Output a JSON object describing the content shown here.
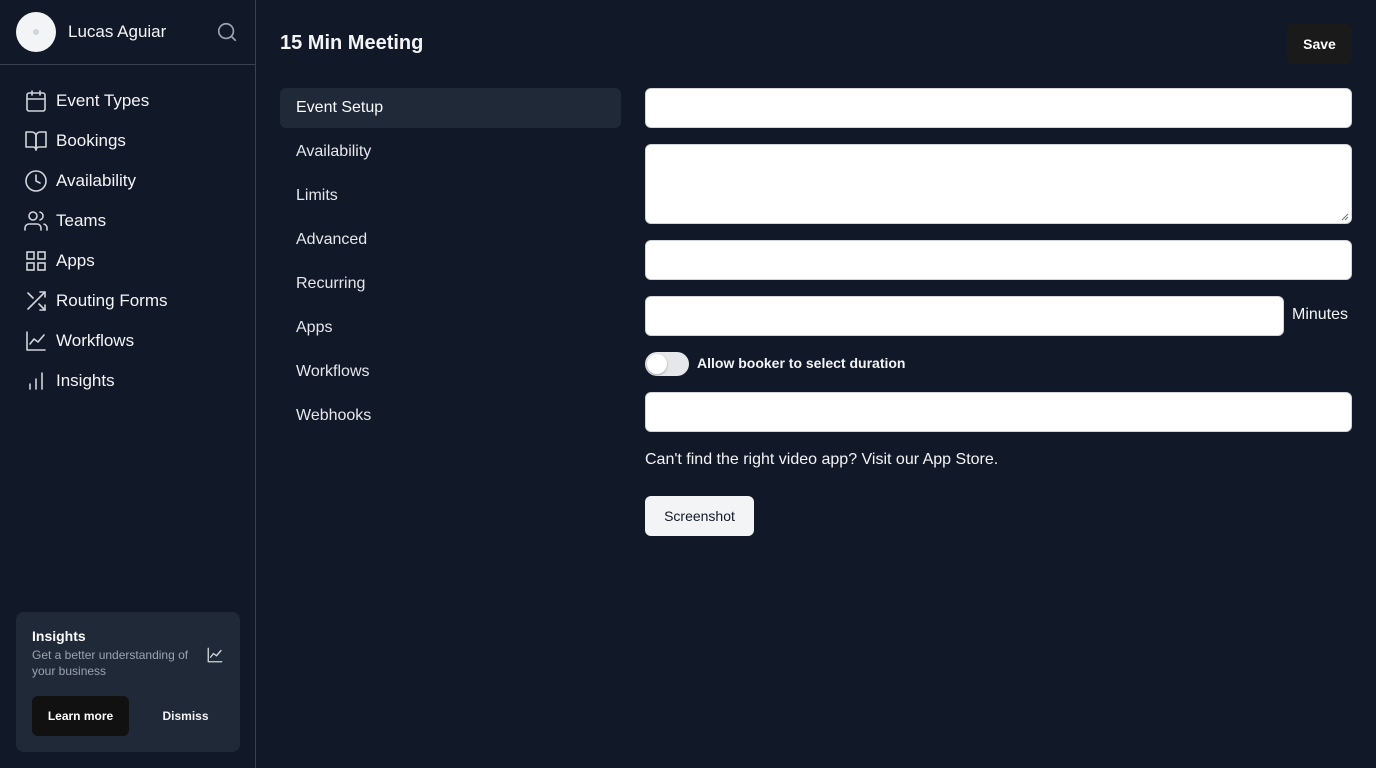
{
  "user": {
    "name": "Lucas Aguiar"
  },
  "sidebar": {
    "items": [
      {
        "label": "Event Types",
        "icon": "calendar-icon"
      },
      {
        "label": "Bookings",
        "icon": "book-open-icon"
      },
      {
        "label": "Availability",
        "icon": "clock-icon"
      },
      {
        "label": "Teams",
        "icon": "users-icon"
      },
      {
        "label": "Apps",
        "icon": "grid-icon"
      },
      {
        "label": "Routing Forms",
        "icon": "shuffle-icon"
      },
      {
        "label": "Workflows",
        "icon": "line-chart-icon"
      },
      {
        "label": "Insights",
        "icon": "bar-chart-icon"
      }
    ]
  },
  "insights_card": {
    "title": "Insights",
    "description": "Get a better understanding of your business",
    "learn_more": "Learn more",
    "dismiss": "Dismiss"
  },
  "header": {
    "title": "15 Min Meeting",
    "save_label": "Save"
  },
  "subnav": {
    "items": [
      {
        "label": "Event Setup",
        "active": true
      },
      {
        "label": "Availability"
      },
      {
        "label": "Limits"
      },
      {
        "label": "Advanced"
      },
      {
        "label": "Recurring"
      },
      {
        "label": "Apps"
      },
      {
        "label": "Workflows"
      },
      {
        "label": "Webhooks"
      }
    ]
  },
  "form": {
    "title_value": "",
    "description_value": "",
    "url_value": "",
    "duration_value": "",
    "duration_unit": "Minutes",
    "allow_duration_toggle_label": "Allow booker to select duration",
    "allow_duration_enabled": false,
    "location_value": "",
    "help_text": "Can't find the right video app? Visit our App Store.",
    "screenshot_button": "Screenshot"
  },
  "colors": {
    "background": "#111827",
    "panel": "#1f2937",
    "border": "#374151",
    "text": "#f3f4f6",
    "muted": "#9ca3af",
    "button_dark": "#1a1a1a"
  }
}
